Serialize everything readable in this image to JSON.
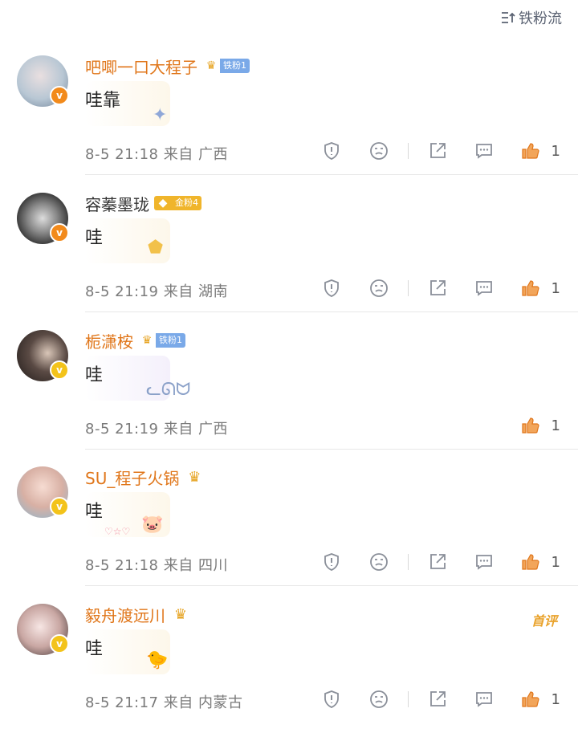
{
  "header": {
    "sort_label": "铁粉流"
  },
  "comments": [
    {
      "user": "吧唧一口大程子",
      "badge_text": "铁粉1",
      "text": "哇靠",
      "time": "8-5 21:18",
      "location": "来自 广西",
      "likes": "1",
      "highlight": false
    },
    {
      "user": "容蓁墨珑",
      "badge_text": "金粉4",
      "text": "哇",
      "time": "8-5 21:19",
      "location": "来自 湖南",
      "likes": "1",
      "highlight": false
    },
    {
      "user": "栀潇桉",
      "badge_text": "铁粉1",
      "text": "哇",
      "time": "8-5 21:19",
      "location": "来自 广西",
      "likes": "1",
      "highlight": false
    },
    {
      "user": "SU_程子火锅",
      "badge_text": "",
      "text": "哇",
      "time": "8-5 21:18",
      "location": "来自 四川",
      "likes": "1",
      "highlight": false
    },
    {
      "user": "毅舟渡远川",
      "badge_text": "",
      "text": "哇",
      "time": "8-5 21:17",
      "location": "来自 内蒙古",
      "likes": "1",
      "first_label": "首评"
    }
  ]
}
